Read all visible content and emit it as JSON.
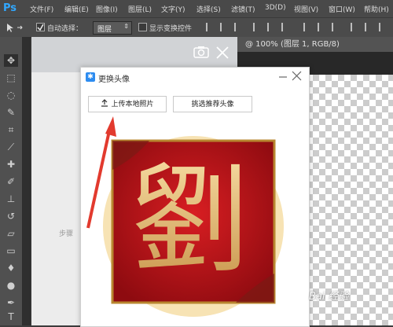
{
  "app": {
    "logo": "Ps"
  },
  "menu": [
    "文件(F)",
    "编辑(E)",
    "图像(I)",
    "图层(L)",
    "文字(Y)",
    "选择(S)",
    "滤镜(T)",
    "3D(D)",
    "视图(V)",
    "窗口(W)",
    "帮助(H)"
  ],
  "options": {
    "auto_select_label": "自动选择：",
    "layer_value": "图层",
    "show_transform_label": "显示变换控件"
  },
  "document": {
    "tab_title": "@ 100% (图层 1, RGB/8)"
  },
  "page_bg": {
    "side_text": "步骤"
  },
  "dialog": {
    "title": "更换头像",
    "upload_label": "上传本地照片",
    "recommend_label": "挑选推荐头像"
  },
  "avatar": {
    "character": "劉"
  },
  "watermark": "Bai 经验",
  "colors": {
    "accent": "#2d8cf0",
    "arrow": "#e23a2e",
    "avatar_red": "#c4121a",
    "avatar_gold": "#e8c27a"
  }
}
